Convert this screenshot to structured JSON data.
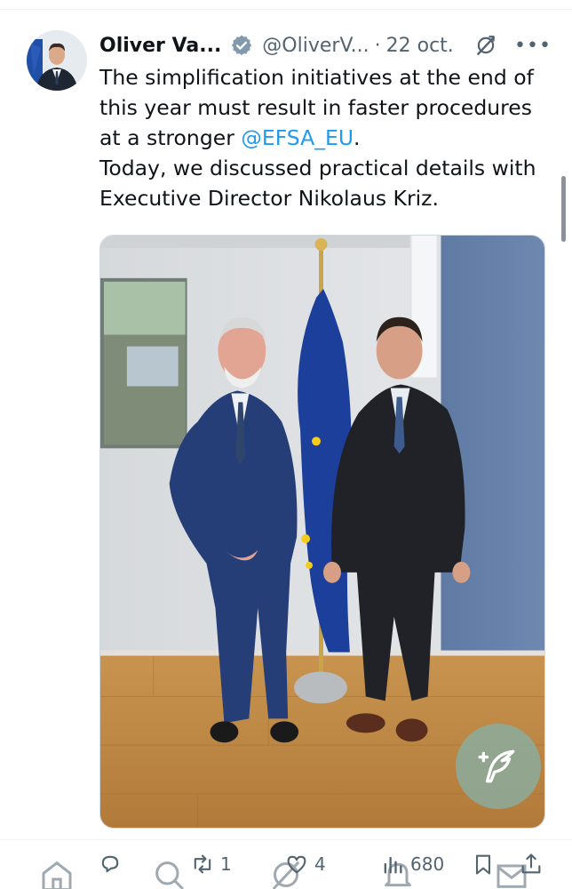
{
  "tweet": {
    "author": {
      "name": "Oliver Va...",
      "handle": "@OliverV...",
      "verified": true
    },
    "separator": "·",
    "timestamp": "22 oct.",
    "more_label": "•••",
    "text_lines": [
      "The simplification initiatives at the end of",
      "this year must result in faster procedures",
      "Today, we discussed practical details with",
      "Executive Director Nikolaus Kriz."
    ],
    "line3_prefix": "at a stronger ",
    "mention": "@EFSA_EU",
    "line3_suffix": ".",
    "stats": {
      "replies": "",
      "reposts": "1",
      "likes": "4",
      "views": "680"
    }
  },
  "icons": {
    "verified": "verified-badge-icon",
    "grok": "grok-icon",
    "reply": "reply-icon",
    "repost": "repost-icon",
    "like": "heart-icon",
    "views": "views-icon",
    "bookmark": "bookmark-icon",
    "share": "share-icon",
    "compose": "compose-post-icon",
    "nav": [
      "home-icon",
      "search-icon",
      "grok-icon",
      "notifications-icon",
      "messages-icon"
    ]
  },
  "colors": {
    "accent": "#1d9bf0",
    "secondary_text": "#536471",
    "primary_text": "#0f1419"
  }
}
